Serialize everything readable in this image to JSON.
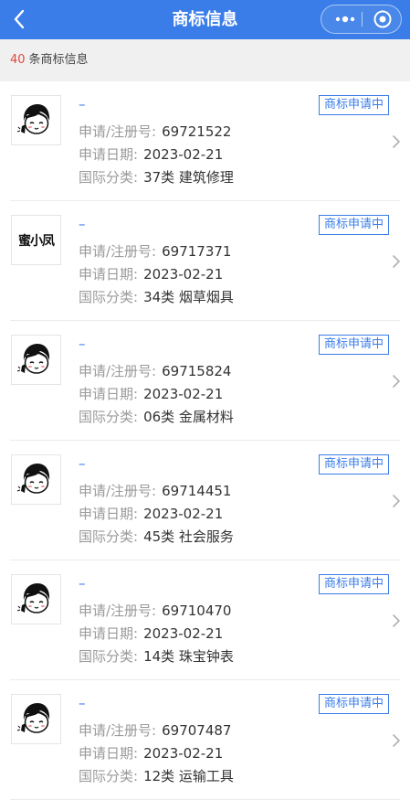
{
  "header": {
    "title": "商标信息",
    "back_icon": "chevron-left-icon",
    "more_icon": "more-dots-icon",
    "close_icon": "target-circle-icon"
  },
  "summary": {
    "count": "40",
    "text": "条商标信息"
  },
  "labels": {
    "reg_no": "申请/注册号:",
    "date": "申请日期:",
    "category": "国际分类:"
  },
  "items": [
    {
      "logo": "cartoon-girl",
      "name": "–",
      "status": "商标申请中",
      "reg_no": "69721522",
      "date": "2023-02-21",
      "category": "37类 建筑修理"
    },
    {
      "logo": "text",
      "logo_text": "蜜小凤",
      "name": "–",
      "status": "商标申请中",
      "reg_no": "69717371",
      "date": "2023-02-21",
      "category": "34类 烟草烟具"
    },
    {
      "logo": "cartoon-girl",
      "name": "–",
      "status": "商标申请中",
      "reg_no": "69715824",
      "date": "2023-02-21",
      "category": "06类 金属材料"
    },
    {
      "logo": "cartoon-girl",
      "name": "–",
      "status": "商标申请中",
      "reg_no": "69714451",
      "date": "2023-02-21",
      "category": "45类 社会服务"
    },
    {
      "logo": "cartoon-girl",
      "name": "–",
      "status": "商标申请中",
      "reg_no": "69710470",
      "date": "2023-02-21",
      "category": "14类 珠宝钟表"
    },
    {
      "logo": "cartoon-girl",
      "name": "–",
      "status": "商标申请中",
      "reg_no": "69707487",
      "date": "2023-02-21",
      "category": "12类 运输工具"
    }
  ],
  "colors": {
    "primary": "#3a7de8",
    "count": "#e0483b",
    "background_bar": "#f0f0f0"
  }
}
